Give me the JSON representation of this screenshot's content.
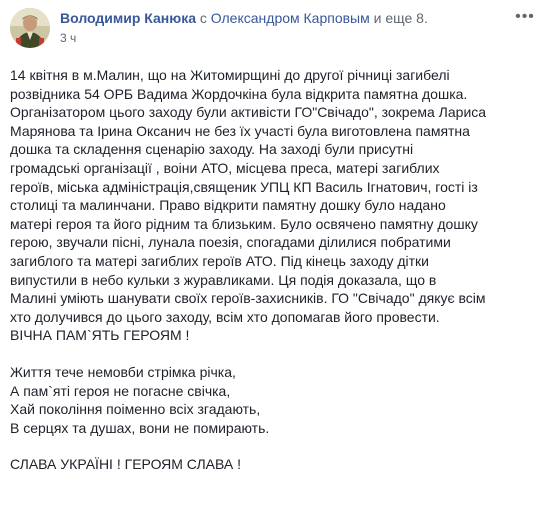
{
  "post": {
    "author": "Володимир Канюка",
    "with_text": "с",
    "tagged": "Олександром Карповым",
    "and_text": "и еще 8.",
    "timestamp": "3 ч",
    "menu_icon": "more-dots-icon",
    "avatar_icon": "profile-avatar",
    "paragraph_lines": [
      "14 квітня в м.Малин, що на Житомирщині до другої річниці загибелі",
      "розвідника 54 ОРБ Вадима Жордочкіна була відкрита памятна дошка.",
      "Організатором цього заходу були активісти ГО\"Свічадо\", зокрема Лариса",
      "Марянова та Ірина Оксанич не без їх участі була виготовлена памятна",
      "дошка та складення сценарію заходу. На заході були присутні",
      "громадські організації , воіни АТО, місцева преса, матері загиблих",
      "героїв, міська адміністрація,священик УПЦ КП Василь Ігнатович, гості із",
      "столиці та малинчани. Право відкрити памятну дошку було надано",
      "матері героя та його рідним та близьким. Було освячено памятну дошку",
      "герою, звучали пісні, лунала поезія, спогадами ділилися побратими",
      "загиблого та матері загиблих героїв АТО. Під кінець заходу дітки",
      "випустили в небо кульки з журавликами. Ця подія доказала, що в",
      "Малині уміють шанувати своїх героїв-захисників. ГО \"Свічадо\" дякує всім",
      "хто долучився до цього заходу, всім хто допомагав його провести.",
      "ВІЧНА ПАМ`ЯТЬ ГЕРОЯМ !"
    ],
    "poem_lines": [
      "Життя тече немовби стрімка річка,",
      "А пам`яті героя не погасне свічка,",
      "Хай покоління поіменно всіх згадають,",
      "В серцях та душах, вони не помирають."
    ],
    "closing": "СЛАВА УКРАЇНІ ! ГЕРОЯМ СЛАВА !"
  }
}
